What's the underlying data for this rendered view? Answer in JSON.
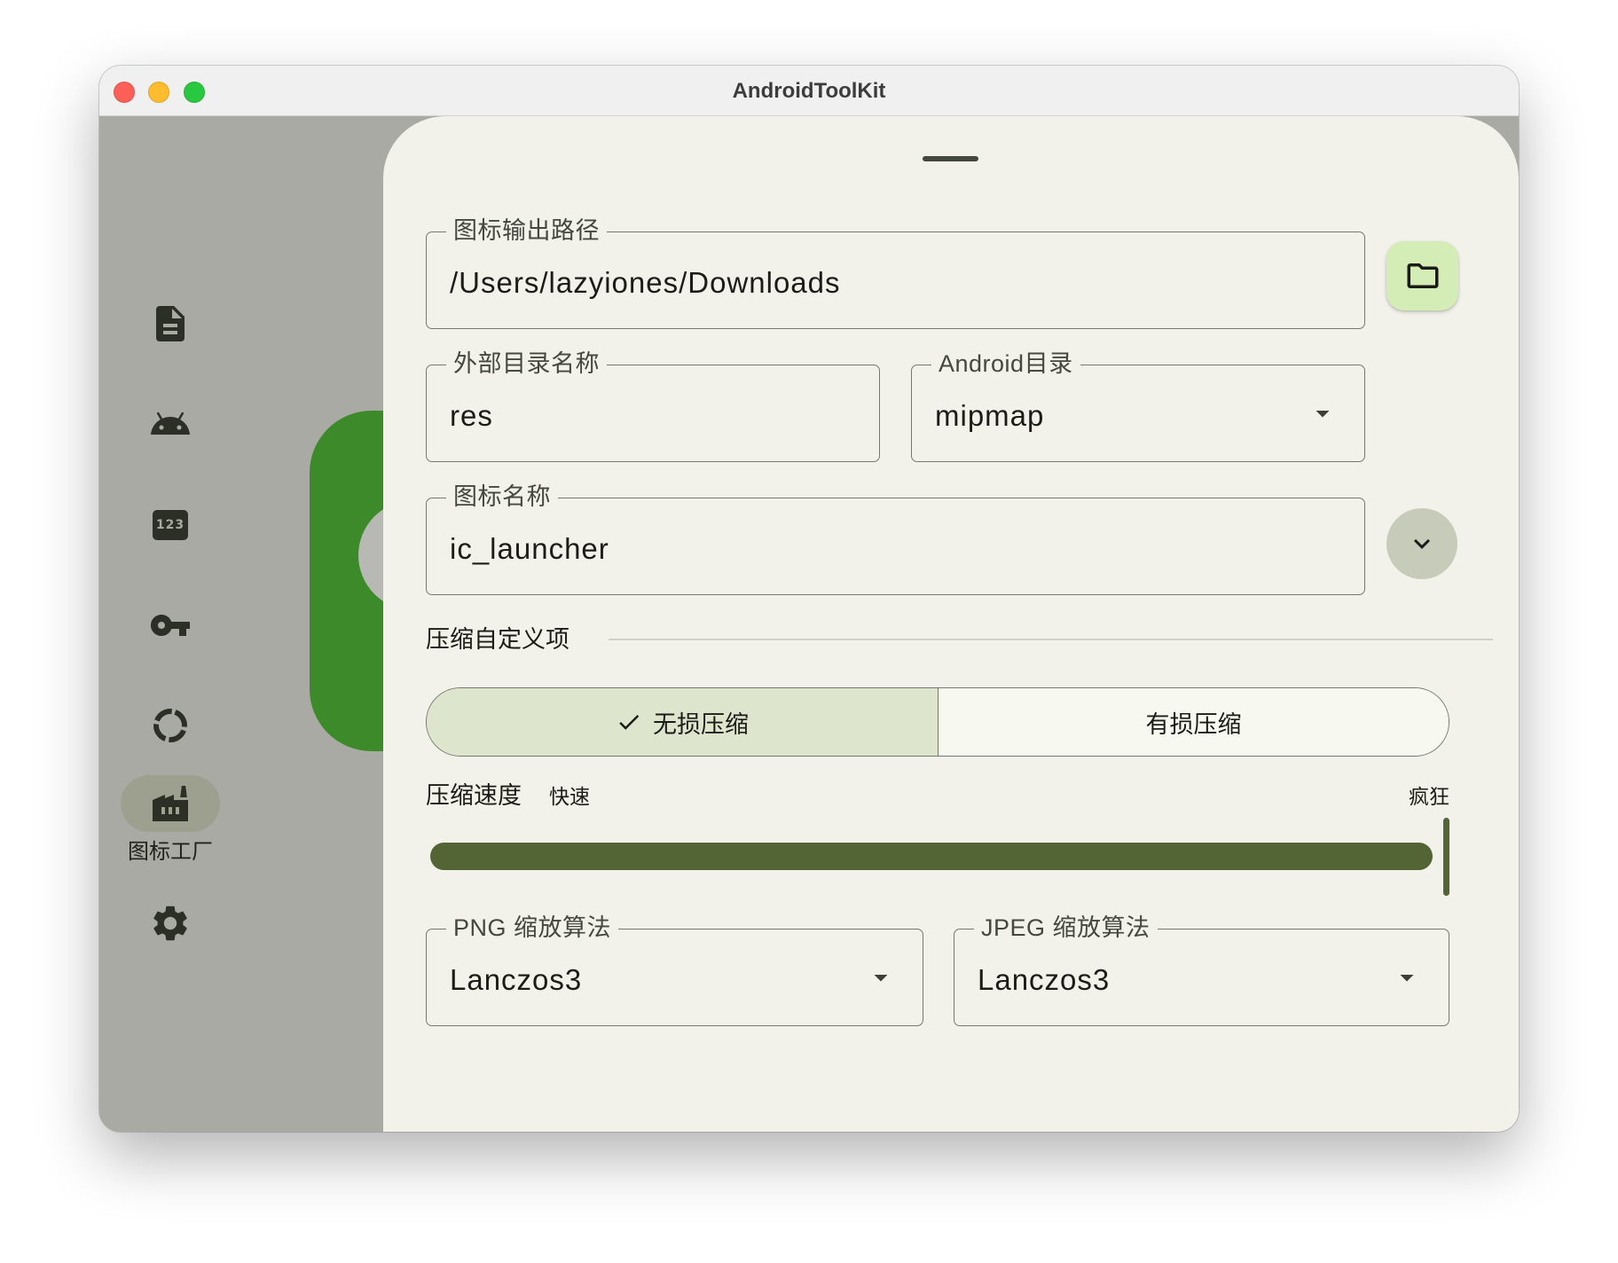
{
  "window": {
    "title": "AndroidToolKit"
  },
  "nav_rail": {
    "items": [
      {
        "icon": "document-icon"
      },
      {
        "icon": "android-icon"
      },
      {
        "icon": "numbers-icon",
        "icon_text": "123"
      },
      {
        "icon": "key-icon"
      },
      {
        "icon": "progress-ring-icon"
      },
      {
        "icon": "factory-icon",
        "label": "图标工厂",
        "selected": true
      },
      {
        "icon": "gear-icon"
      }
    ]
  },
  "sheet": {
    "output_path": {
      "label": "图标输出路径",
      "value": "/Users/lazyiones/Downloads",
      "action_icon": "folder-icon"
    },
    "external_dir": {
      "label": "外部目录名称",
      "value": "res"
    },
    "android_dir": {
      "label": "Android目录",
      "value": "mipmap",
      "icon": "arrow-drop-down-icon"
    },
    "icon_name": {
      "label": "图标名称",
      "value": "ic_launcher",
      "action_icon": "chevron-down-icon"
    },
    "compression_section": {
      "title": "压缩自定义项"
    },
    "compression_mode": {
      "options": [
        {
          "label": "无损压缩",
          "selected": true
        },
        {
          "label": "有损压缩",
          "selected": false
        }
      ]
    },
    "speed": {
      "label": "压缩速度",
      "value_label": "快速",
      "max_label": "疯狂",
      "fraction": 1.0
    },
    "png_algorithm": {
      "label": "PNG 缩放算法",
      "value": "Lanczos3",
      "icon": "arrow-drop-down-icon"
    },
    "jpeg_algorithm": {
      "label": "JPEG 缩放算法",
      "value": "Lanczos3",
      "icon": "arrow-drop-down-icon"
    }
  },
  "theme": {
    "scrim": "#a9aaa4",
    "surface": "#f2f2ea",
    "outline": "#75796c",
    "on_surface": "#1b1c17",
    "on_surface_variant": "#44483d",
    "primary": "#536535",
    "primary_container": "#d4ecb6",
    "secondary_container": "#dde6cd",
    "segment_unselected": "#f7f8ef",
    "nav_indicator": "#9da08f",
    "nav_icon": "#2b2f25",
    "preview_green": "#3c8a29",
    "preview_circle": "#b8b9b4",
    "expand_button": "#c7cbb9",
    "divider": "#cfd1c6",
    "title_bar": "#f0f0f0",
    "light_close": "#fe5f57",
    "light_minimize": "#febc2e",
    "light_zoom": "#28c840"
  }
}
